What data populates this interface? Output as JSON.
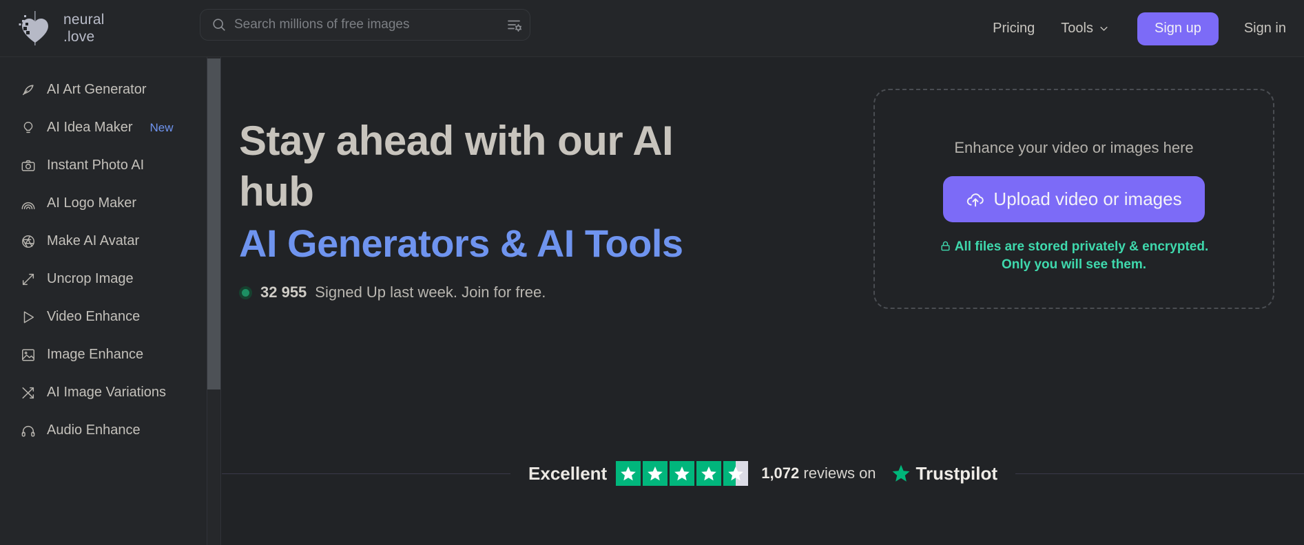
{
  "brand": {
    "name_line1": "neural",
    "name_line2": ".love",
    "logo_icon": "heart-logo-icon"
  },
  "search": {
    "placeholder": "Search millions of free images",
    "value": "",
    "icon": "search-icon",
    "filter_icon": "filter-settings-icon"
  },
  "nav": {
    "pricing": "Pricing",
    "tools": "Tools",
    "tools_caret_icon": "chevron-down-icon",
    "sign_up": "Sign up",
    "sign_in": "Sign in"
  },
  "sidebar": {
    "items": [
      {
        "label": "AI Art Generator",
        "icon": "feather-pen-icon",
        "badge": ""
      },
      {
        "label": "AI Idea Maker",
        "icon": "lightbulb-icon",
        "badge": "New"
      },
      {
        "label": "Instant Photo AI",
        "icon": "camera-icon",
        "badge": ""
      },
      {
        "label": "AI Logo Maker",
        "icon": "rainbow-arch-icon",
        "badge": ""
      },
      {
        "label": "Make AI Avatar",
        "icon": "aperture-icon",
        "badge": ""
      },
      {
        "label": "Uncrop Image",
        "icon": "expand-arrows-icon",
        "badge": ""
      },
      {
        "label": "Video Enhance",
        "icon": "play-triangle-icon",
        "badge": ""
      },
      {
        "label": "Image Enhance",
        "icon": "picture-icon",
        "badge": ""
      },
      {
        "label": "AI Image Variations",
        "icon": "shuffle-icon",
        "badge": ""
      },
      {
        "label": "Audio Enhance",
        "icon": "headphones-icon",
        "badge": ""
      }
    ]
  },
  "hero": {
    "title": "Stay ahead with our AI hub",
    "subtitle": "AI Generators & AI Tools",
    "stat_count": "32 955",
    "stat_text": "Signed Up last week. Join for free."
  },
  "upload": {
    "hint": "Enhance your video or images here",
    "button_label": "Upload video or images",
    "button_icon": "cloud-upload-icon",
    "privacy_line1": "All files are stored privately & encrypted.",
    "privacy_line2": "Only you will see them.",
    "privacy_icon": "lock-icon"
  },
  "trustpilot": {
    "rating_word": "Excellent",
    "stars_filled": 4,
    "stars_half": 1,
    "review_count": "1,072",
    "reviews_text": "reviews on",
    "brand": "Trustpilot",
    "star_icon": "star-icon"
  },
  "colors": {
    "accent_purple": "#7c6bf7",
    "accent_blue": "#6f94ef",
    "accent_green": "#3fd9ad",
    "trustpilot_green": "#01b67c",
    "page_bg": "#212326",
    "panel_bg": "#242629"
  }
}
